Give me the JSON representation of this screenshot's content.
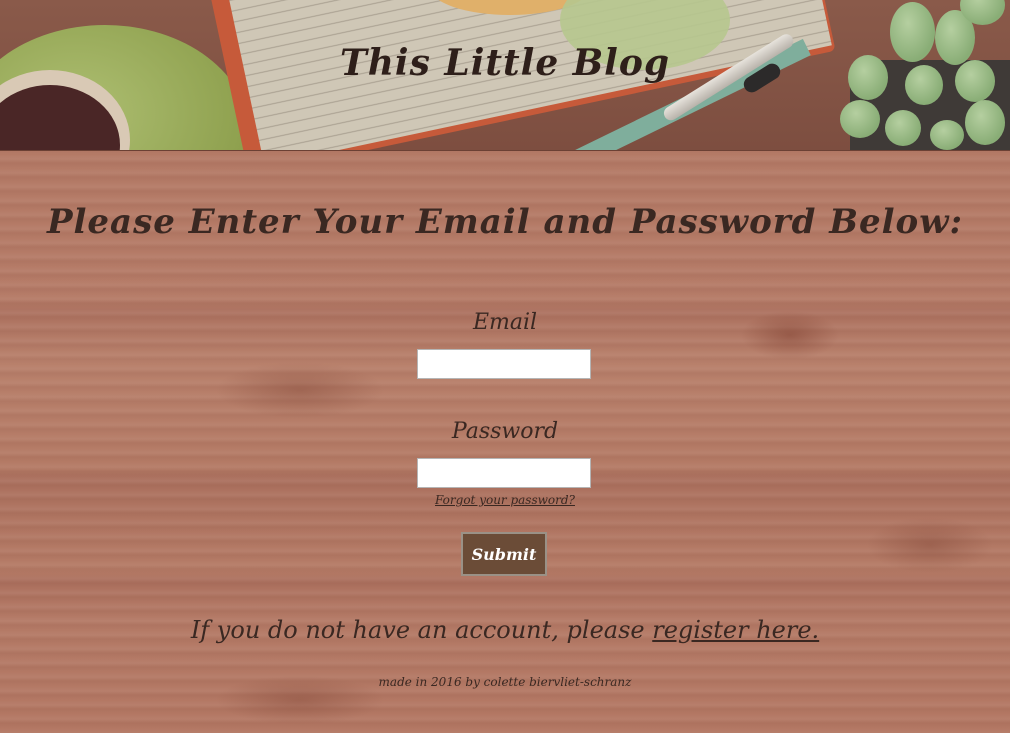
{
  "header": {
    "title": "This Little Blog"
  },
  "form": {
    "heading": "Please Enter Your Email and Password Below:",
    "email_label": "Email",
    "email_value": "",
    "password_label": "Password",
    "password_value": "",
    "forgot_link": "Forgot your password?",
    "submit_label": "Submit"
  },
  "register": {
    "prefix": "If you do not have an account, please ",
    "link_label": "register here."
  },
  "footer": {
    "credit": "made in 2016 by colette biervliet-schranz"
  },
  "colors": {
    "button_background": "#6b4c37",
    "text": "#3a2822",
    "wood_background": "#b37562"
  }
}
